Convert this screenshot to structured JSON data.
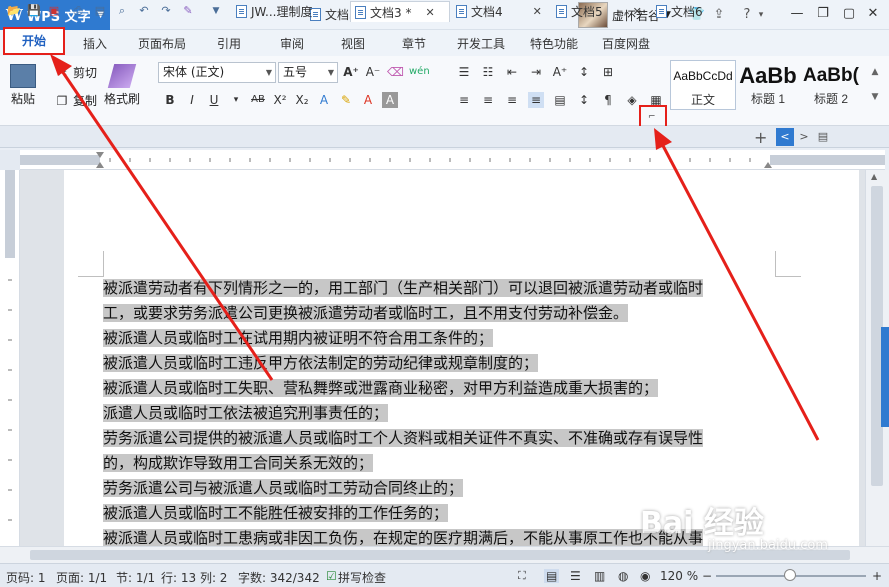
{
  "app": {
    "title": "WPS 文字",
    "doc_title": "文档3 * - WPS 文字",
    "user_name": "虚怀若谷"
  },
  "menu": {
    "tabs": [
      "开始",
      "插入",
      "页面布局",
      "引用",
      "审阅",
      "视图",
      "章节",
      "开发工具",
      "特色功能",
      "百度网盘"
    ]
  },
  "ribbon": {
    "paste": "粘贴",
    "cut": "剪切",
    "copy": "复制",
    "format_painter": "格式刷",
    "font_name": "宋体 (正文)",
    "font_size": "五号",
    "styles": [
      {
        "sample": "AaBbCcDd",
        "label": "正文"
      },
      {
        "sample": "AaBb",
        "label": "标题 1"
      },
      {
        "sample": "AaBb(",
        "label": "标题 2"
      }
    ],
    "accent_color": "#2f7ad0"
  },
  "doc_tabs": [
    {
      "label": "JW...理制度",
      "active": false
    },
    {
      "label": "文档3 *",
      "active": true
    },
    {
      "label": "文档4",
      "active": false
    },
    {
      "label": "文档5",
      "active": false
    },
    {
      "label": "文档6",
      "active": false
    }
  ],
  "document": {
    "lines": [
      "被派遣劳动者有下列情形之一的，用工部门（生产相关部门）可以退回被派遣劳动者或临时",
      "工，或要求劳务派遣公司更换被派遣劳动者或临时工，且不用支付劳动补偿金。",
      "被派遣人员或临时工在试用期内被证明不符合用工条件的；",
      "被派遣人员或临时工违反甲方依法制定的劳动纪律或规章制度的；",
      "被派遣人员或临时工失职、营私舞弊或泄露商业秘密，对甲方利益造成重大损害的；",
      "派遣人员或临时工依法被追究刑事责任的；",
      "劳务派遣公司提供的被派遣人员或临时工个人资料或相关证件不真实、不准确或存有误导性",
      "的，构成欺诈导致用工合同关系无效的；",
      "劳务派遣公司与被派遣人员或临时工劳动合同终止的；",
      "被派遣人员或临时工不能胜任被安排的工作任务的；",
      "被派遣人员或临时工患病或非因工负伤，在规定的医疗期满后，不能从事原工作也不能从事"
    ]
  },
  "status": {
    "page_num": "页码: 1",
    "pages": "页面: 1/1",
    "section": "节: 1/1",
    "row_col": "行: 13  列: 2",
    "word_count": "字数: 342/342",
    "spell_check": "拼写检查",
    "zoom": "120 %"
  },
  "watermark": {
    "text": "Bai 经验",
    "url": "jingyan.baidu.com"
  }
}
